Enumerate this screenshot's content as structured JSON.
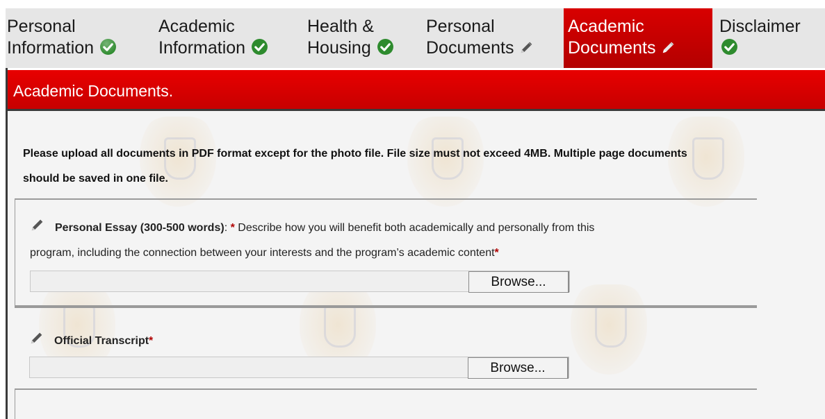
{
  "tabs": [
    {
      "line1": "Personal",
      "line2": "Information",
      "status_icon": "check-circle-icon"
    },
    {
      "line1": "Academic",
      "line2": "Information",
      "status_icon": "check-circle-icon"
    },
    {
      "line1": "Health &",
      "line2": "Housing",
      "status_icon": "check-circle-icon"
    },
    {
      "line1": "Personal",
      "line2": "Documents",
      "status_icon": "pencil-icon"
    },
    {
      "line1": "Academic",
      "line2": "Documents",
      "status_icon": "pencil-icon",
      "active": true
    },
    {
      "line1": "Disclaimer",
      "line2": "",
      "status_icon": "check-circle-icon"
    }
  ],
  "panel": {
    "title": "Academic Documents.",
    "instructions_line1": "Please upload all documents in PDF format except for the photo file. File size must not exceed 4MB. Multiple page documents",
    "instructions_line2": "should be saved in one file."
  },
  "documents": [
    {
      "title": "Personal Essay (300-500 words)",
      "colon": ": ",
      "asterisk": "*",
      "description_line1": " Describe how you will benefit both academically and personally from this",
      "description_line2": "program, including the connection between your interests and the program’s academic content",
      "required_mark": "*",
      "browse_label": "Browse..."
    },
    {
      "title": "Official Transcript",
      "required_mark": "*",
      "browse_label": "Browse..."
    }
  ],
  "colors": {
    "active_tab": "#c00000",
    "header_red": "#e00000",
    "check_green": "#2e8b2e",
    "required_red": "#b00000"
  }
}
